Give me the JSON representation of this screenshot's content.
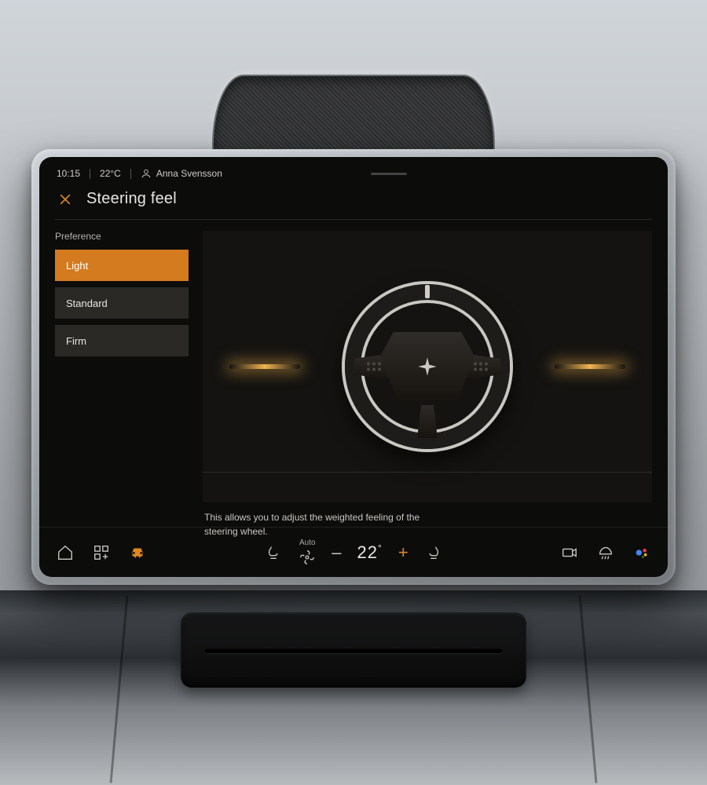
{
  "status": {
    "time": "10:15",
    "temperature": "22°C",
    "user_name": "Anna Svensson"
  },
  "page": {
    "title": "Steering feel",
    "preference_label": "Preference",
    "options": [
      {
        "label": "Light",
        "selected": true
      },
      {
        "label": "Standard",
        "selected": false
      },
      {
        "label": "Firm",
        "selected": false
      }
    ],
    "description": "This allows you to adjust the weighted feeling of the steering wheel."
  },
  "climate": {
    "fan_mode": "Auto",
    "temperature_value": "22",
    "temperature_unit": "°"
  },
  "colors": {
    "accent": "#e08626",
    "background": "#0c0c0b"
  }
}
